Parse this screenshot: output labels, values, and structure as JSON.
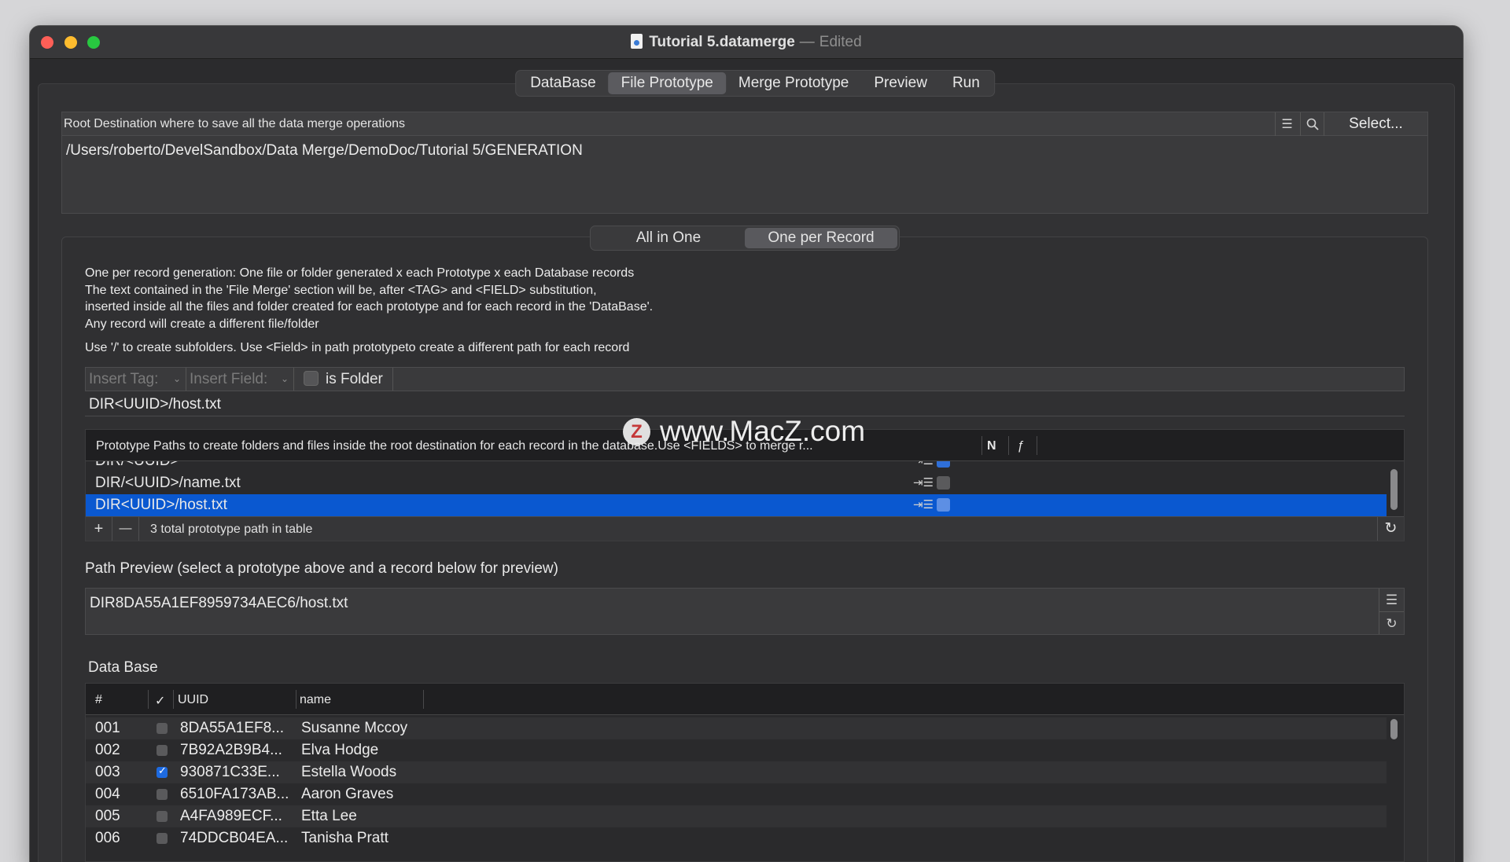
{
  "window": {
    "title": "Tutorial 5.datamerge",
    "separator": "—",
    "edited": "Edited"
  },
  "tabs": [
    {
      "label": "DataBase"
    },
    {
      "label": "File Prototype",
      "active": true
    },
    {
      "label": "Merge Prototype"
    },
    {
      "label": "Preview"
    },
    {
      "label": "Run"
    }
  ],
  "root": {
    "label": "Root Destination where to save all the data merge operations",
    "select_label": "Select...",
    "path": "/Users/roberto/DevelSandbox/Data Merge/DemoDoc/Tutorial 5/GENERATION"
  },
  "mode": {
    "options": [
      "All in One",
      "One per Record"
    ],
    "selected": "One per Record"
  },
  "description": {
    "line1": "One per record generation: One file or folder  generated x each Prototype x each Database records",
    "line2": "The text contained in the 'File Merge' section will be, after <TAG> and <FIELD> substitution,",
    "line3": "inserted inside all the files and folder created for each prototype and for each record in the 'DataBase'.",
    "line4": "Any record will create a different file/folder",
    "hint": "Use '/' to create subfolders.  Use <Field> in path prototypeto create a different path for each record"
  },
  "toolbar": {
    "insert_tag": "Insert Tag:",
    "insert_field": "Insert Field:",
    "is_folder": "is Folder"
  },
  "path_field": "DIR<UUID>/host.txt",
  "proto_table": {
    "header_path": "Prototype Paths to create folders and  files inside the root destination for each record in the database.Use <FIELDS> to merge r...",
    "header_n": "N",
    "header_f": "ƒ",
    "rows": [
      {
        "path": "DIR/<UUID>"
      },
      {
        "path": "DIR/<UUID>/name.txt"
      },
      {
        "path": "DIR<UUID>/host.txt"
      }
    ],
    "footer_add": "+",
    "footer_remove": "—",
    "count_text": "3 total prototype path in table"
  },
  "preview": {
    "label": "Path Preview (select a prototype above and a record below for preview)",
    "value": "DIR8DA55A1EF8959734AEC6/host.txt"
  },
  "database": {
    "label": "Data Base",
    "columns": {
      "num": "#",
      "check": "✓",
      "uuid": "UUID",
      "name": "name"
    },
    "rows": [
      {
        "num": "001",
        "uuid": "8DA55A1EF8...",
        "name": "Susanne Mccoy",
        "checked": false
      },
      {
        "num": "002",
        "uuid": "7B92A2B9B4...",
        "name": "Elva Hodge",
        "checked": false
      },
      {
        "num": "003",
        "uuid": "930871C33E...",
        "name": "Estella Woods",
        "checked": true
      },
      {
        "num": "004",
        "uuid": "6510FA173AB...",
        "name": "Aaron Graves",
        "checked": false
      },
      {
        "num": "005",
        "uuid": "A4FA989ECF...",
        "name": "Etta Lee",
        "checked": false
      },
      {
        "num": "006",
        "uuid": "74DDCB04EA...",
        "name": "Tanisha Pratt",
        "checked": false
      }
    ]
  },
  "watermark": {
    "badge": "Z",
    "text": "www.MacZ.com"
  },
  "colors": {
    "selection": "#0a58d0",
    "accent_checkbox": "#1d6ae0"
  }
}
